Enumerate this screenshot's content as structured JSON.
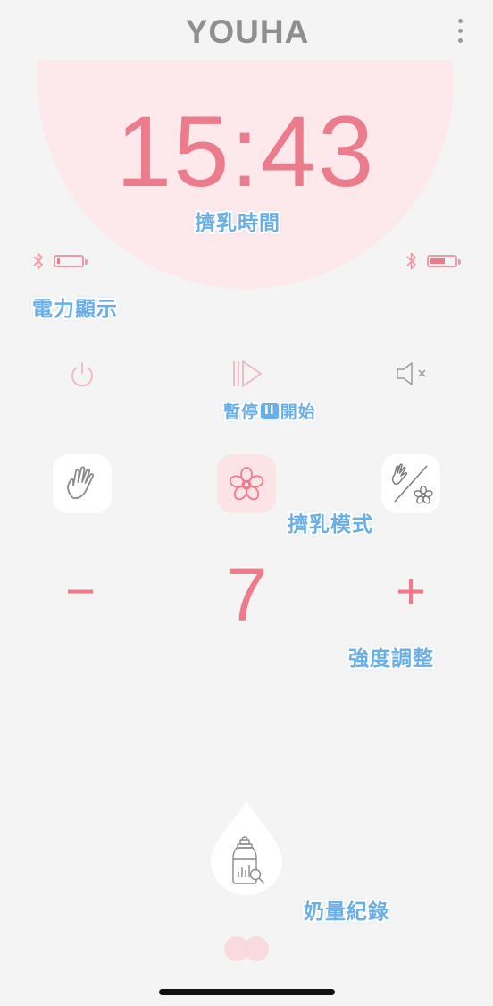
{
  "header": {
    "logo_text": "YOUHA",
    "menu_icon": "more-vertical-icon"
  },
  "timer": {
    "value": "15:43",
    "caption": "擠乳時間"
  },
  "battery": {
    "left_level": 0.12,
    "right_level": 0.6,
    "caption": "電力顯示",
    "icon": "bluetooth-icon"
  },
  "controls": {
    "power_icon": "power-icon",
    "play_pause_icon": "play-pause-icon",
    "mute_icon": "speaker-mute-icon",
    "caption_left": "暫停",
    "caption_mid": "II",
    "caption_right": "開始"
  },
  "modes": {
    "items": [
      {
        "icon": "hand-icon",
        "active": false
      },
      {
        "icon": "flower-icon",
        "active": true
      },
      {
        "icon": "hand-flower-icon",
        "active": false
      }
    ],
    "caption": "擠乳模式"
  },
  "intensity": {
    "value": "7",
    "minus": "−",
    "plus": "+",
    "caption": "強度調整"
  },
  "milk_record": {
    "icon": "baby-bottle-icon",
    "caption": "奶量紀錄"
  },
  "colors": {
    "accent": "#ec7b8c",
    "disc": "#fde9eb",
    "annotation": "#6aaee8"
  }
}
